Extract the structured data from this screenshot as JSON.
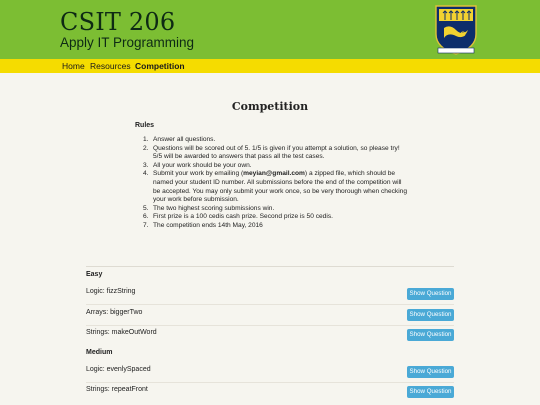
{
  "header": {
    "course_code": "CSIT 206",
    "course_name": "Apply IT Programming",
    "colors": {
      "banner": "#7cbe33",
      "nav": "#f5dc00",
      "button": "#4aa9d6"
    }
  },
  "nav": {
    "items": [
      {
        "label": "Home"
      },
      {
        "label": "Resources"
      },
      {
        "label": "Competition"
      }
    ]
  },
  "page": {
    "title": "Competition",
    "rules_heading": "Rules",
    "rules": [
      {
        "num": "1.",
        "text": "Answer all questions."
      },
      {
        "num": "2.",
        "text": "Questions will be scored out of 5. 1/5 is given if you attempt a solution, so please try! 5/5 will be awarded to answers that pass all the test cases."
      },
      {
        "num": "3.",
        "text": "All your work should be your own."
      },
      {
        "num": "4.",
        "text_pre": "Submit your work by emailing (",
        "email": "meyian@gmail.com",
        "text_post": ") a zipped file, which should be named your student ID number. All submissions before the end of the competition will be accepted. You may only submit your work once, so be very thorough when checking your work before submission."
      },
      {
        "num": "5.",
        "text": "The two highest scoring submissions win."
      },
      {
        "num": "6.",
        "text": "First prize is a 100 cedis cash prize. Second prize is 50 cedis."
      },
      {
        "num": "7.",
        "text": "The competition ends 14th May, 2016"
      }
    ]
  },
  "sections": {
    "easy": {
      "heading": "Easy",
      "questions": [
        {
          "label": "Logic: fizzString",
          "button": "Show Question"
        },
        {
          "label": "Arrays: biggerTwo",
          "button": "Show Question"
        },
        {
          "label": "Strings: makeOutWord",
          "button": "Show Question"
        }
      ]
    },
    "medium": {
      "heading": "Medium",
      "questions": [
        {
          "label": "Logic: evenlySpaced",
          "button": "Show Question"
        },
        {
          "label": "Strings: repeatFront",
          "button": "Show Question"
        }
      ]
    }
  }
}
